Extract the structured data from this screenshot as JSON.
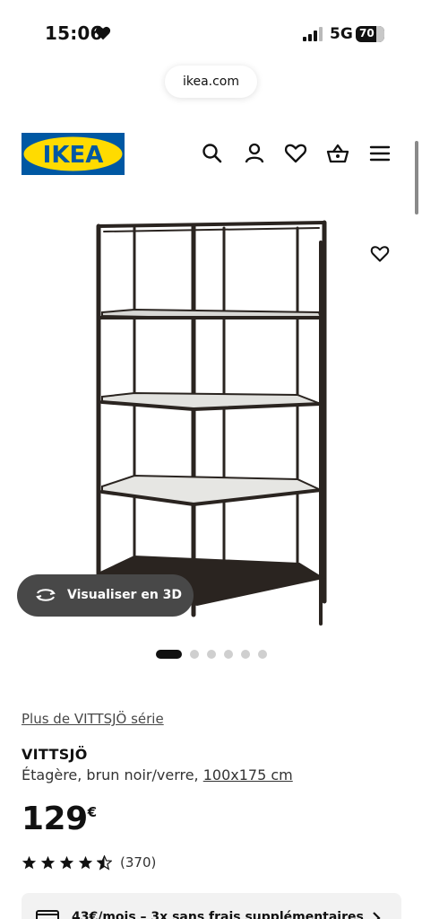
{
  "status_bar": {
    "time": "15:06",
    "network": "5G",
    "battery": "70"
  },
  "browser": {
    "url": "ikea.com"
  },
  "header": {
    "logo_text": "IKEA",
    "icons": [
      "search-icon",
      "user-icon",
      "heart-icon",
      "basket-icon",
      "menu-icon"
    ]
  },
  "product": {
    "view_3d_label": "Visualiser en 3D",
    "carousel": {
      "total": 6,
      "active": 1
    },
    "series_link": "Plus de VITTSJÖ série",
    "name": "VITTSJÖ",
    "description": "Étagère, brun noir/verre, ",
    "dimensions": "100x175 cm",
    "price": "129",
    "currency": "€",
    "rating": 4.5,
    "reviews": "(370)"
  },
  "payment": {
    "text": "43€/mois – 3x sans frais supplémentaires"
  },
  "colors": {
    "ikea_blue": "#0058a3",
    "ikea_yellow": "#ffdb00",
    "frame": "#2a2420"
  }
}
